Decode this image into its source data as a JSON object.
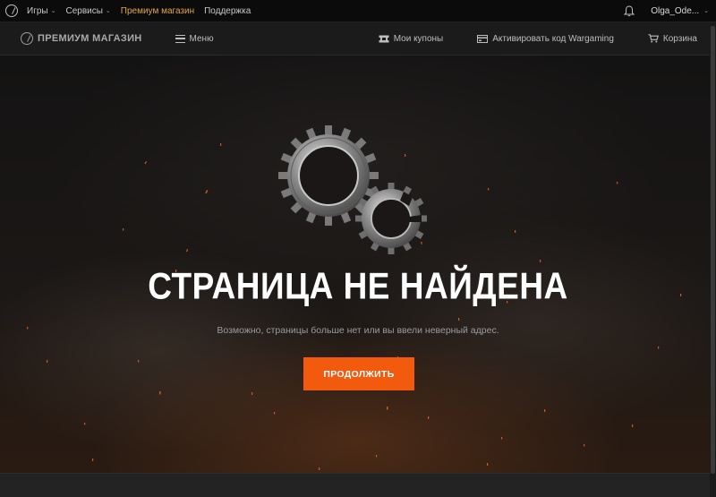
{
  "topbar": {
    "nav": [
      {
        "label": "Игры",
        "has_dropdown": true,
        "active": false
      },
      {
        "label": "Сервисы",
        "has_dropdown": true,
        "active": false
      },
      {
        "label": "Премиум магазин",
        "has_dropdown": false,
        "active": true
      },
      {
        "label": "Поддержка",
        "has_dropdown": false,
        "active": false
      }
    ],
    "user_name": "Olga_Ode...",
    "icons": {
      "logo": "wargaming-logo-icon",
      "notifications": "bell-icon",
      "dropdown": "chevron-down-icon"
    }
  },
  "storebar": {
    "brand": "ПРЕМИУМ МАГАЗИН",
    "menu_label": "Меню",
    "coupons_label": "Мои купоны",
    "activate_label": "Активировать код Wargaming",
    "cart_label": "Корзина"
  },
  "hero": {
    "title": "СТРАНИЦА НЕ НАЙДЕНА",
    "subtitle": "Возможно, страницы больше нет или вы ввели неверный адрес.",
    "button_label": "ПРОДОЛЖИТЬ",
    "illustration": "broken-gears-icon"
  },
  "colors": {
    "accent": "#f25a0d",
    "active_nav": "#e1a54a",
    "title": "#ffffff"
  }
}
